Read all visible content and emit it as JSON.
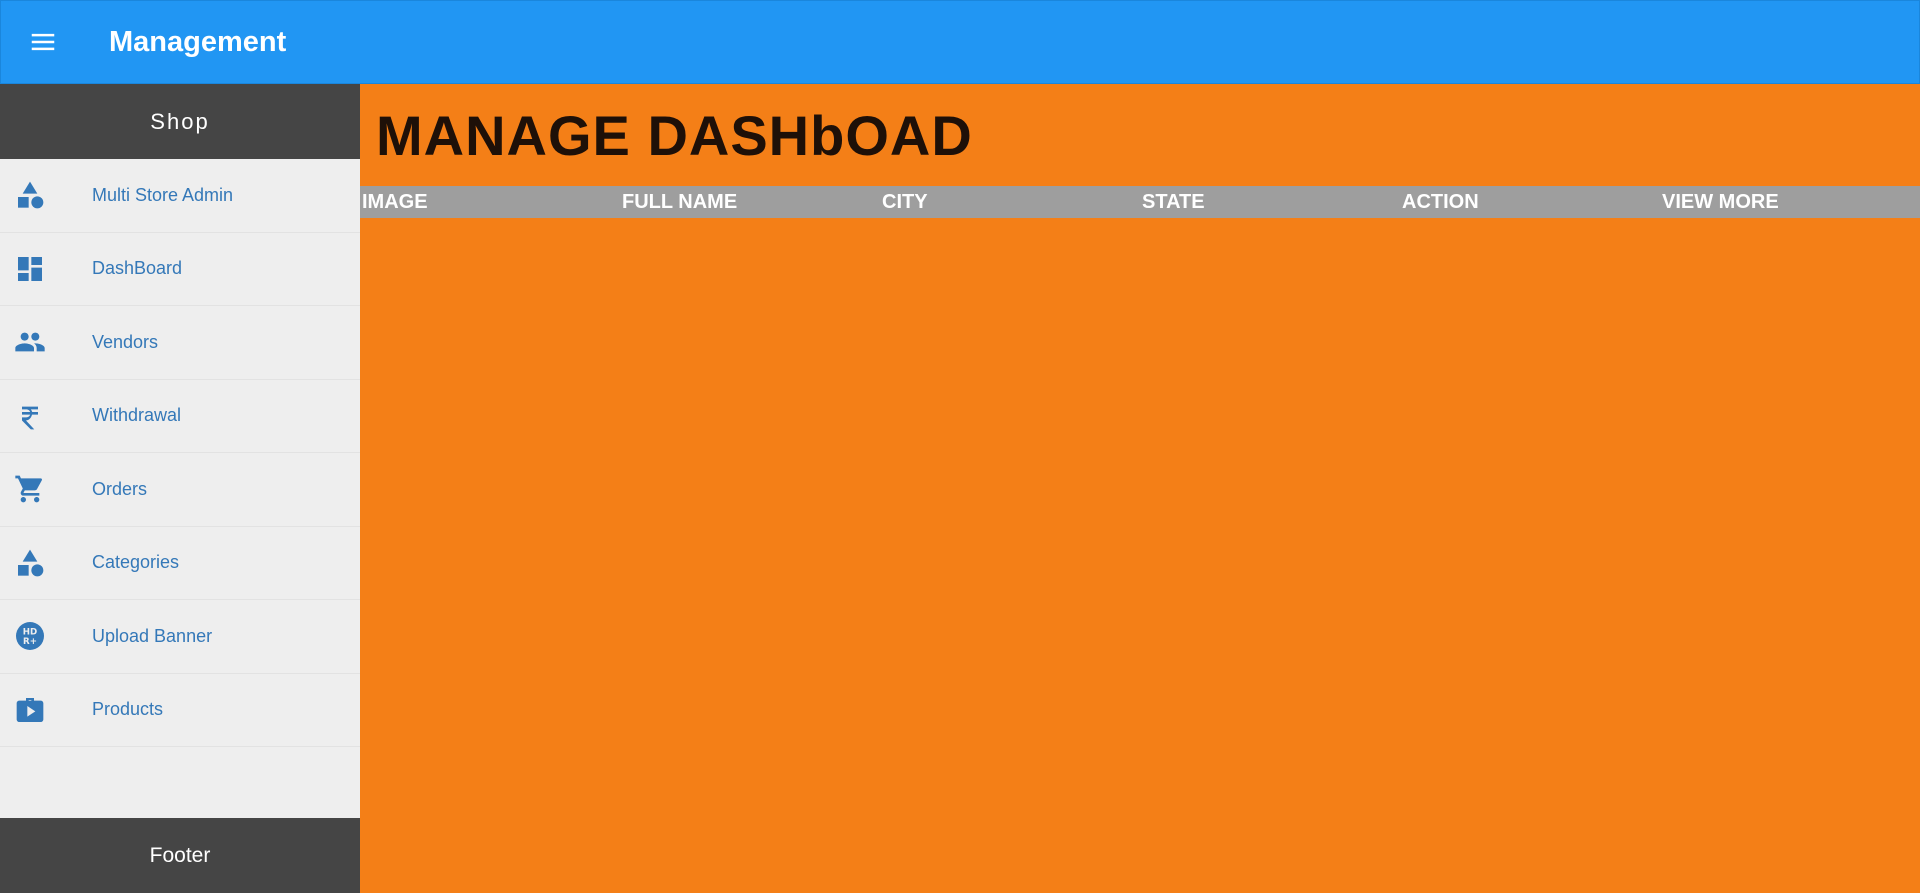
{
  "app": {
    "title": "Management",
    "brand_color": "#2196f3",
    "main_bg_color": "#f47f17"
  },
  "topbar": {
    "menu_icon": "hamburger-menu-icon"
  },
  "sidebar": {
    "header": "Shop",
    "items": [
      {
        "label": "Multi Store Admin",
        "icon": "category-shapes-icon"
      },
      {
        "label": "DashBoard",
        "icon": "dashboard-icon"
      },
      {
        "label": "Vendors",
        "icon": "people-icon"
      },
      {
        "label": "Withdrawal",
        "icon": "rupee-icon"
      },
      {
        "label": "Orders",
        "icon": "shopping-cart-icon"
      },
      {
        "label": "Categories",
        "icon": "category-shapes-icon"
      },
      {
        "label": "Upload Banner",
        "icon": "hdr-plus-icon"
      },
      {
        "label": "Products",
        "icon": "video-briefcase-icon"
      }
    ],
    "footer": "Footer"
  },
  "main": {
    "title": "MANAGE DASHbOAD",
    "table": {
      "columns": [
        "IMAGE",
        "FULL NAME",
        "CITY",
        "STATE",
        "ACTION",
        "VIEW MORE"
      ]
    }
  }
}
